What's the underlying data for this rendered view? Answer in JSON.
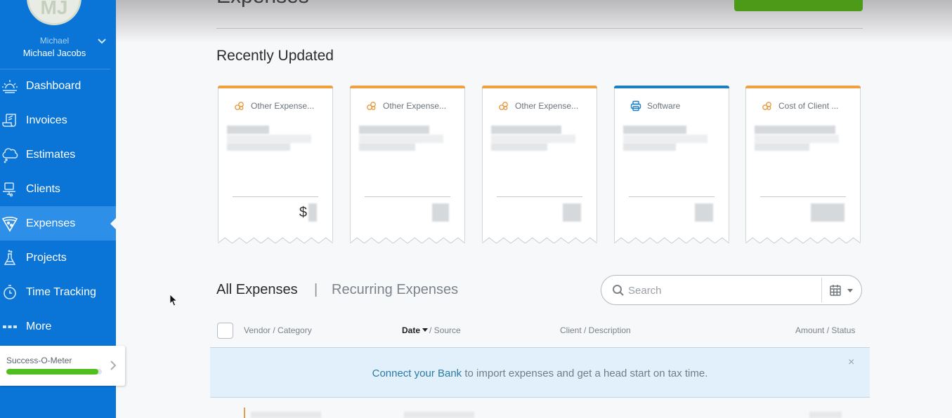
{
  "sidebar": {
    "avatar_initials": "MJ",
    "user_first_name": "Michael",
    "user_full_name": "Michael Jacobs",
    "items": [
      {
        "label": "Dashboard",
        "icon": "sun-horizon-icon",
        "active": false
      },
      {
        "label": "Invoices",
        "icon": "scroll-icon",
        "active": false
      },
      {
        "label": "Estimates",
        "icon": "thought-cloud-icon",
        "active": false
      },
      {
        "label": "Clients",
        "icon": "person-desk-icon",
        "active": false
      },
      {
        "label": "Expenses",
        "icon": "pizza-slice-icon",
        "active": true
      },
      {
        "label": "Projects",
        "icon": "flask-icon",
        "active": false
      },
      {
        "label": "Time Tracking",
        "icon": "stopwatch-icon",
        "active": false
      },
      {
        "label": "More",
        "icon": "dots-icon",
        "active": false
      }
    ],
    "success_meter": {
      "label": "Success-O-Meter",
      "progress_percent": 96
    }
  },
  "header": {
    "title": "Expenses"
  },
  "recently_updated": {
    "title": "Recently Updated",
    "cards": [
      {
        "category": "Other Expense...",
        "icon": "bubbles-icon",
        "accent": "#f0a040",
        "amount_prefix": "$"
      },
      {
        "category": "Other Expense...",
        "icon": "bubbles-icon",
        "accent": "#f0a040",
        "amount_prefix": ""
      },
      {
        "category": "Other Expense...",
        "icon": "bubbles-icon",
        "accent": "#f0a040",
        "amount_prefix": ""
      },
      {
        "category": "Software",
        "icon": "printer-icon",
        "accent": "#1a7fc4",
        "amount_prefix": ""
      },
      {
        "category": "Cost of Client ...",
        "icon": "bubbles-icon",
        "accent": "#f0a040",
        "amount_prefix": ""
      }
    ]
  },
  "tabs": {
    "all": "All Expenses",
    "separator": "|",
    "recurring": "Recurring Expenses"
  },
  "search": {
    "placeholder": "Search",
    "value": ""
  },
  "table": {
    "columns": {
      "vendor": "Vendor / Category",
      "date": "Date",
      "source": "/ Source",
      "client": "Client / Description",
      "amount": "Amount / Status"
    }
  },
  "banner": {
    "link": "Connect your Bank",
    "text": " to import expenses and get a head start on tax time.",
    "close": "×"
  },
  "colors": {
    "sidebar": "#0a75d6",
    "sidebar_active": "#2d8fe8",
    "primary_button": "#4d9a19",
    "accent_orange": "#f0a040",
    "accent_blue": "#1a7fc4",
    "banner_bg": "#e2f0fb"
  }
}
